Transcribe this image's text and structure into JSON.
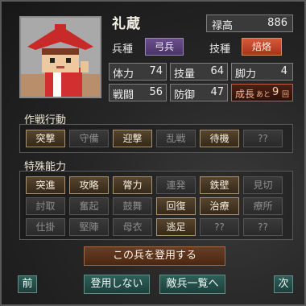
{
  "character": {
    "name": "礼蔵",
    "stipend_label": "禄高",
    "stipend_value": "886",
    "unit_label": "兵種",
    "unit_value": "弓兵",
    "skill_label": "技種",
    "skill_value": "焙烙"
  },
  "stats": [
    {
      "label": "体力",
      "value": "74"
    },
    {
      "label": "技量",
      "value": "64"
    },
    {
      "label": "脚力",
      "value": "4"
    },
    {
      "label": "戦闘",
      "value": "56"
    },
    {
      "label": "防御",
      "value": "47"
    }
  ],
  "growth": {
    "prefix": "成長",
    "small": "あと",
    "value": "9",
    "suffix": "回"
  },
  "tactics": {
    "title": "作戦行動",
    "items": [
      {
        "label": "突撃",
        "enabled": true
      },
      {
        "label": "守備",
        "enabled": false
      },
      {
        "label": "迎撃",
        "enabled": true
      },
      {
        "label": "乱戦",
        "enabled": false
      },
      {
        "label": "待機",
        "enabled": true
      },
      {
        "label": "??",
        "enabled": false
      }
    ]
  },
  "abilities": {
    "title": "特殊能力",
    "rows": [
      [
        {
          "label": "突進",
          "enabled": true
        },
        {
          "label": "攻略",
          "enabled": true
        },
        {
          "label": "膂力",
          "enabled": true
        },
        {
          "label": "連発",
          "enabled": false
        },
        {
          "label": "鉄壁",
          "enabled": true
        },
        {
          "label": "見切",
          "enabled": false
        }
      ],
      [
        {
          "label": "討取",
          "enabled": false
        },
        {
          "label": "奮起",
          "enabled": false
        },
        {
          "label": "鼓舞",
          "enabled": false
        },
        {
          "label": "回復",
          "enabled": true
        },
        {
          "label": "治療",
          "enabled": true
        },
        {
          "label": "療所",
          "enabled": false
        }
      ],
      [
        {
          "label": "仕掛",
          "enabled": false
        },
        {
          "label": "堅陣",
          "enabled": false
        },
        {
          "label": "母衣",
          "enabled": false
        },
        {
          "label": "逃足",
          "enabled": true
        },
        {
          "label": "??",
          "enabled": false
        },
        {
          "label": "??",
          "enabled": false
        }
      ]
    ]
  },
  "actions": {
    "recruit": "この兵を登用する",
    "prev": "前",
    "decline": "登用しない",
    "enemy_list": "敵兵一覧へ",
    "next": "次"
  }
}
